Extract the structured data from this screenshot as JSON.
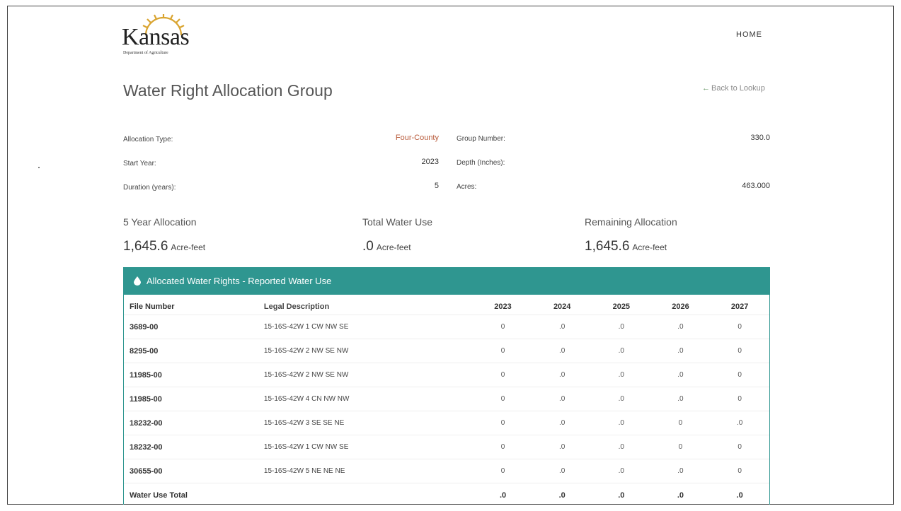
{
  "header": {
    "logo_word": "Kansas",
    "logo_sub": "Department of Agriculture",
    "nav_home": "HOME"
  },
  "page": {
    "title": "Water Right Allocation Group",
    "back_link": "Back to Lookup"
  },
  "fields": {
    "allocation_type_label": "Allocation Type:",
    "allocation_type_value": "Four-County",
    "group_number_label": "Group Number:",
    "group_number_value": "330.0",
    "start_year_label": "Start Year:",
    "start_year_value": "2023",
    "depth_label": "Depth (Inches):",
    "depth_value": "",
    "duration_label": "Duration (years):",
    "duration_value": "5",
    "acres_label": "Acres:",
    "acres_value": "463.000"
  },
  "summary": {
    "allocation_label": "5 Year Allocation",
    "allocation_value": "1,645.6",
    "total_use_label": "Total Water Use",
    "total_use_value": ".0",
    "remaining_label": "Remaining Allocation",
    "remaining_value": "1,645.6",
    "unit": "Acre-feet"
  },
  "panel": {
    "title": "Allocated Water Rights - Reported Water Use",
    "icon": "water-drop-icon",
    "color": "#2f9690"
  },
  "table": {
    "headers": {
      "file": "File Number",
      "legal": "Legal Description",
      "y1": "2023",
      "y2": "2024",
      "y3": "2025",
      "y4": "2026",
      "y5": "2027"
    },
    "rows": [
      {
        "file": "3689-00",
        "legal": "15-16S-42W 1 CW NW SE",
        "y1": "0",
        "y2": ".0",
        "y3": ".0",
        "y4": ".0",
        "y5": "0"
      },
      {
        "file": "8295-00",
        "legal": "15-16S-42W 2 NW SE NW",
        "y1": "0",
        "y2": ".0",
        "y3": ".0",
        "y4": ".0",
        "y5": "0"
      },
      {
        "file": "11985-00",
        "legal": "15-16S-42W 2 NW SE NW",
        "y1": "0",
        "y2": ".0",
        "y3": ".0",
        "y4": ".0",
        "y5": "0"
      },
      {
        "file": "11985-00",
        "legal": "15-16S-42W 4 CN NW NW",
        "y1": "0",
        "y2": ".0",
        "y3": ".0",
        "y4": ".0",
        "y5": "0"
      },
      {
        "file": "18232-00",
        "legal": "15-16S-42W 3 SE SE NE",
        "y1": "0",
        "y2": ".0",
        "y3": ".0",
        "y4": "0",
        "y5": ".0"
      },
      {
        "file": "18232-00",
        "legal": "15-16S-42W 1 CW NW SE",
        "y1": "0",
        "y2": ".0",
        "y3": ".0",
        "y4": "0",
        "y5": "0"
      },
      {
        "file": "30655-00",
        "legal": "15-16S-42W 5 NE NE NE",
        "y1": "0",
        "y2": ".0",
        "y3": ".0",
        "y4": ".0",
        "y5": "0"
      }
    ],
    "total": {
      "label": "Water Use Total",
      "y1": ".0",
      "y2": ".0",
      "y3": ".0",
      "y4": ".0",
      "y5": ".0"
    }
  }
}
